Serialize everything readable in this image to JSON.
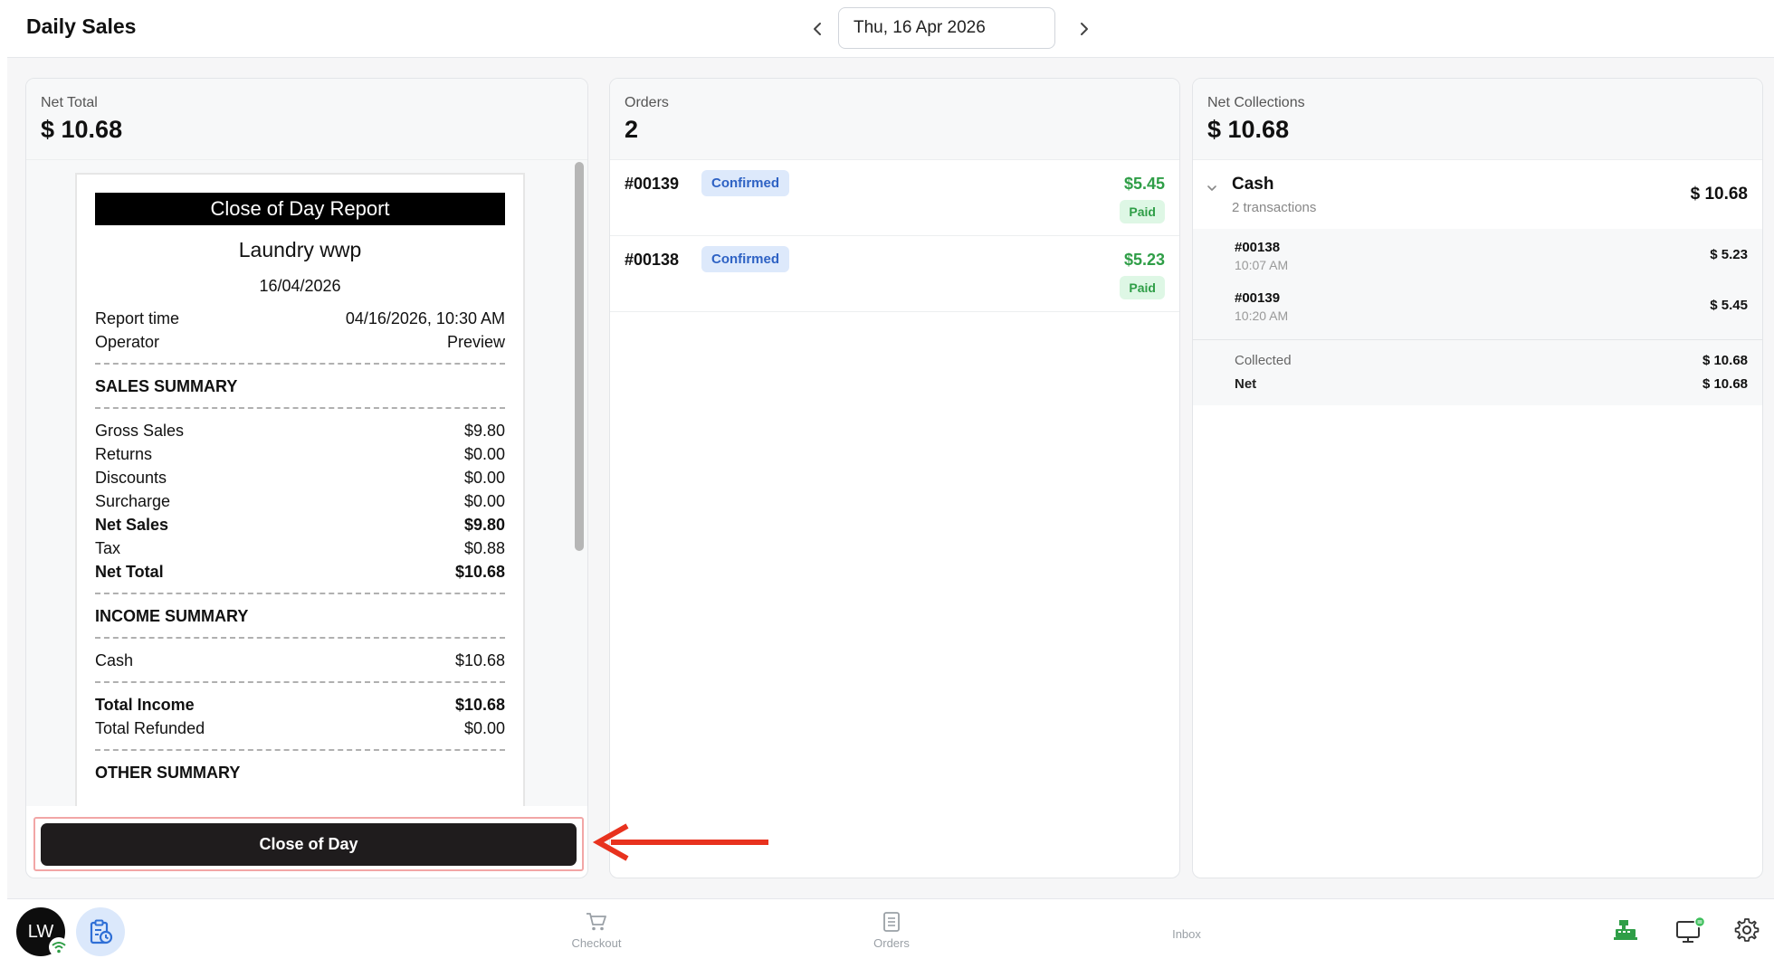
{
  "header": {
    "title": "Daily Sales",
    "date": "Thu, 16 Apr 2026"
  },
  "net_total": {
    "label": "Net Total",
    "value": "$ 10.68"
  },
  "orders_panel": {
    "label": "Orders",
    "count": "2"
  },
  "net_collections": {
    "label": "Net Collections",
    "value": "$ 10.68"
  },
  "report": {
    "title": "Close of Day Report",
    "store": "Laundry wwp",
    "date": "16/04/2026",
    "meta": [
      {
        "label": "Report time",
        "value": "04/16/2026, 10:30 AM"
      },
      {
        "label": "Operator",
        "value": "Preview"
      }
    ],
    "sales_summary_title": "SALES SUMMARY",
    "sales": [
      {
        "label": "Gross Sales",
        "value": "$9.80"
      },
      {
        "label": "Returns",
        "value": "$0.00"
      },
      {
        "label": "Discounts",
        "value": "$0.00"
      },
      {
        "label": "Surcharge",
        "value": "$0.00"
      },
      {
        "label": "Net Sales",
        "value": "$9.80"
      },
      {
        "label": "Tax",
        "value": "$0.88"
      },
      {
        "label": "Net Total",
        "value": "$10.68"
      }
    ],
    "income_summary_title": "INCOME SUMMARY",
    "income": [
      {
        "label": "Cash",
        "value": "$10.68"
      }
    ],
    "totals": [
      {
        "label": "Total Income",
        "value": "$10.68"
      },
      {
        "label": "Total Refunded",
        "value": "$0.00"
      }
    ],
    "other_summary_title": "OTHER SUMMARY"
  },
  "close_button_label": "Close of Day",
  "orders": [
    {
      "id": "#00139",
      "status": "Confirmed",
      "amount": "$5.45",
      "payment": "Paid"
    },
    {
      "id": "#00138",
      "status": "Confirmed",
      "amount": "$5.23",
      "payment": "Paid"
    }
  ],
  "collections": {
    "method": "Cash",
    "transactions_text": "2 transactions",
    "total": "$ 10.68",
    "transactions": [
      {
        "id": "#00138",
        "time": "10:07 AM",
        "amount": "$ 5.23"
      },
      {
        "id": "#00139",
        "time": "10:20 AM",
        "amount": "$ 5.45"
      }
    ],
    "collected_label": "Collected",
    "collected_value": "$ 10.68",
    "net_label": "Net",
    "net_value": "$ 10.68"
  },
  "bottom_nav": {
    "avatar": "LW",
    "checkout": "Checkout",
    "orders": "Orders",
    "inbox": "Inbox"
  },
  "colors": {
    "accent_green": "#2f9e47",
    "confirmed_blue": "#2e62c4",
    "annotation_red": "#e8321e",
    "button_dark": "#1f1c1d"
  },
  "icons": [
    "chevron-left-icon",
    "chevron-right-icon",
    "chevron-down-icon",
    "wifi-icon",
    "report-clock-icon",
    "cart-icon",
    "orders-list-icon",
    "cash-register-icon",
    "monitor-icon",
    "gear-icon",
    "red-arrow-icon"
  ]
}
